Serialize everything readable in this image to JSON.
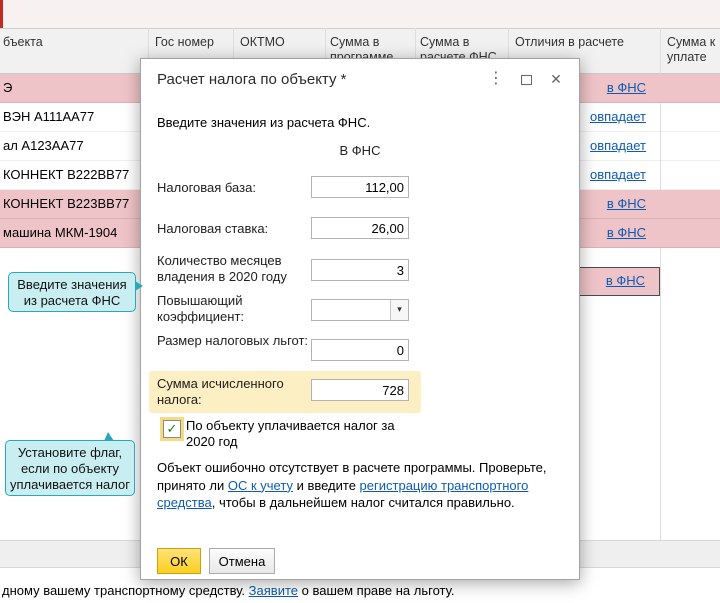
{
  "icons": {
    "kebab": "⋮",
    "close": "✕",
    "dropdown": "▾",
    "check": "✓"
  },
  "table": {
    "headers": {
      "object": "бъекта",
      "gos": "Гос номер",
      "oktmo": "ОКТМО",
      "sum_prog": "Сумма в программе",
      "sum_fns": "Сумма в расчете ФНС",
      "diff": "Отличия в расчете",
      "sum_pay": "Сумма к уплате"
    },
    "rows": [
      {
        "object": "Э",
        "diff": "в ФНС"
      },
      {
        "object": "ВЭН А111АА77",
        "diff": "овпадает"
      },
      {
        "object": "ал А123АА77",
        "diff": "овпадает"
      },
      {
        "object": "КОННЕКТ В222ВВ77",
        "diff": "овпадает"
      },
      {
        "object": "КОННЕКТ В223ВВ77",
        "diff": "в ФНС"
      },
      {
        "object": "машина МКМ-1904",
        "diff": "в ФНС"
      },
      {
        "object": "",
        "diff": "в ФНС"
      }
    ]
  },
  "footer": {
    "prefix": "дному вашему транспортному средству. ",
    "link": "Заявите",
    "suffix": " о вашем праве на льготу."
  },
  "dialog": {
    "title": "Расчет налога по объекту *",
    "intro": "Введите значения из расчета ФНС.",
    "column_header": "В ФНС",
    "fields": [
      {
        "label": "Налоговая база:",
        "value": "112,00"
      },
      {
        "label": "Налоговая ставка:",
        "value": "26,00"
      },
      {
        "label": "Количество месяцев владения в 2020 году",
        "value": "3"
      },
      {
        "label": "Повышающий коэффициент:",
        "value": ""
      },
      {
        "label": "Размер налоговых льгот:",
        "value": "0"
      },
      {
        "label": "Сумма исчисленного налога:",
        "value": "728"
      }
    ],
    "checkbox_label": "По объекту уплачивается налог за 2020 год",
    "note": {
      "text1": "Объект ошибочно отсутствует в расчете программы. Проверьте, принято ли ",
      "link1": "ОС к учету",
      "text2": " и введите ",
      "link2": "регистрацию транспортного средства",
      "text3": ", чтобы в дальнейшем налог считался правильно."
    },
    "ok": "ОК",
    "cancel": "Отмена"
  },
  "callouts": [
    {
      "lines": [
        "Введите значения",
        "из расчета ФНС",
        ""
      ]
    },
    {
      "lines": [
        "Установите флаг,",
        "если по объекту",
        "уплачивается налог"
      ]
    }
  ],
  "colors": {
    "pink_row": "#efc4c8",
    "yellow_highlight": "#fcefc3",
    "callout_bg": "#c9eef1",
    "callout_border": "#2aa7b8",
    "ok_button": "#fccf1f",
    "link": "#0e5bb5"
  }
}
